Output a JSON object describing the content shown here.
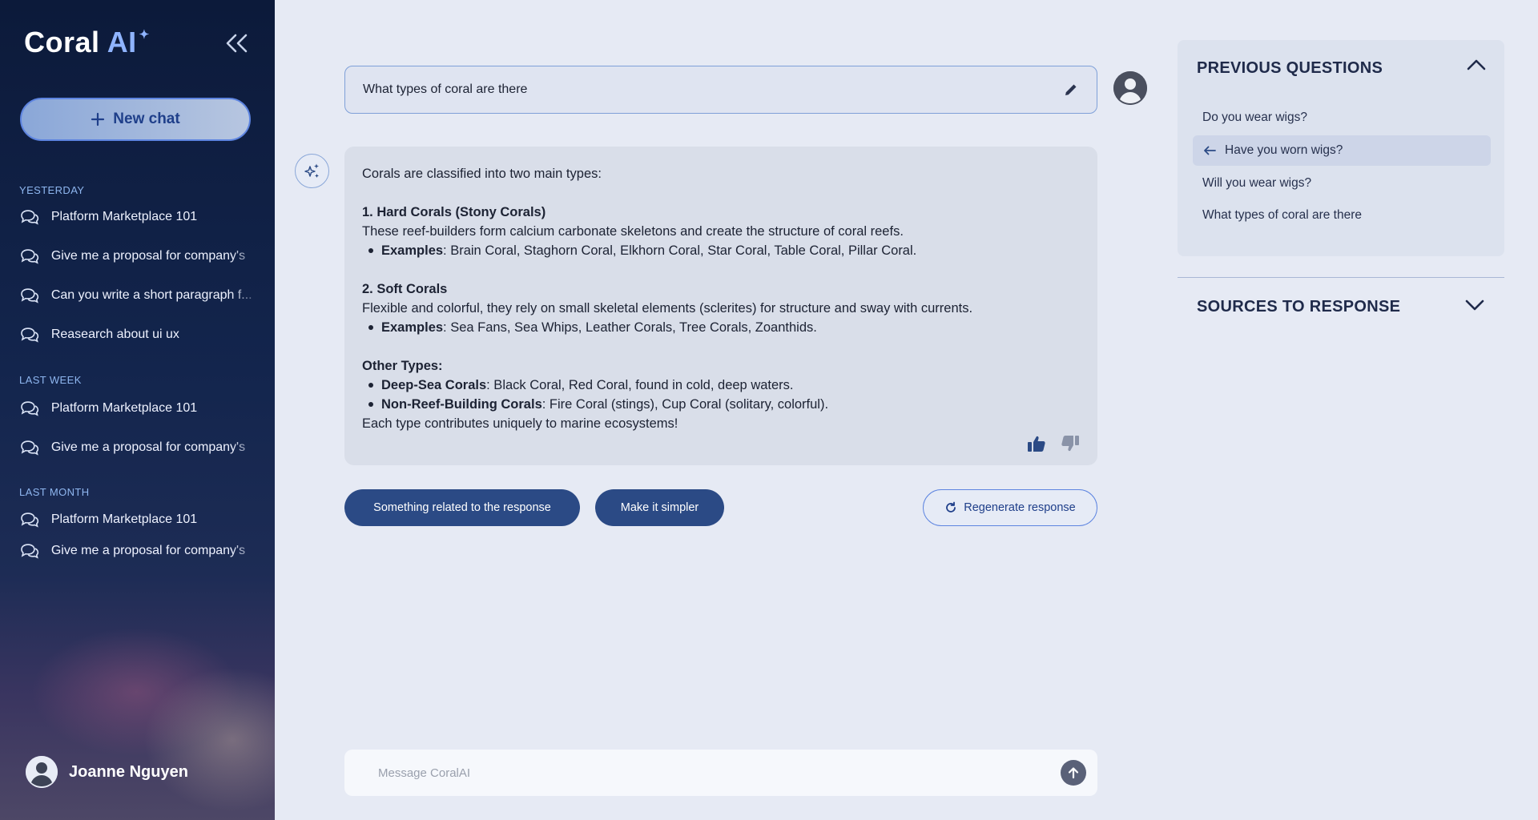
{
  "sidebar": {
    "logo": {
      "brand": "Coral ",
      "ai": "AI",
      "spark": "✦"
    },
    "new_chat_label": "New chat",
    "sections": [
      {
        "label": "YESTERDAY",
        "items": [
          "Platform Marketplace 101",
          "Give me a proposal for company's",
          "Can you write a short paragraph f...",
          "Reasearch about ui ux"
        ]
      },
      {
        "label": "LAST WEEK",
        "items": [
          "Platform Marketplace 101",
          "Give me a proposal for company's"
        ]
      },
      {
        "label": "LAST MONTH",
        "items": [
          "Platform Marketplace 101",
          "Give me a proposal for company's"
        ]
      }
    ],
    "user_name": "Joanne Nguyen"
  },
  "main": {
    "question": "What types of coral are there",
    "answer": {
      "intro": "Corals are classified into two main types:",
      "hard_title": "1. Hard Corals (Stony Corals)",
      "hard_desc": "These reef-builders form calcium carbonate skeletons and create the structure of coral reefs.",
      "hard_examples_label": "Examples",
      "hard_examples": ": Brain Coral, Staghorn Coral, Elkhorn Coral, Star Coral, Table Coral, Pillar Coral.",
      "soft_title": "2. Soft Corals",
      "soft_desc": "Flexible and colorful, they rely on small skeletal elements (sclerites) for structure and sway with currents.",
      "soft_examples_label": "Examples",
      "soft_examples": ": Sea Fans, Sea Whips, Leather Corals, Tree Corals, Zoanthids.",
      "other_title": "Other Types:",
      "deep_label": "Deep-Sea Corals",
      "deep_text": ": Black Coral, Red Coral, found in cold, deep waters.",
      "nonreef_label": "Non-Reef-Building Corals",
      "nonreef_text": ": Fire Coral (stings), Cup Coral (solitary, colorful).",
      "closing": "Each type contributes uniquely to marine ecosystems!"
    },
    "suggestions": [
      "Something related to the response",
      "Make it simpler"
    ],
    "regenerate_label": "Regenerate response",
    "composer_placeholder": "Message CoralAI"
  },
  "right_panel": {
    "previous_title": "PREVIOUS QUESTIONS",
    "previous_questions": [
      "Do you wear wigs?",
      "Have you worn wigs?",
      "Will you wear wigs?",
      "What types of coral are there"
    ],
    "active_index": 1,
    "sources_title": "SOURCES TO RESPONSE"
  },
  "colors": {
    "sidebar_bg": "#0c1a3a",
    "accent": "#2b4a85",
    "highlight": "#5d84e0",
    "page_bg": "#e6eaf4"
  }
}
